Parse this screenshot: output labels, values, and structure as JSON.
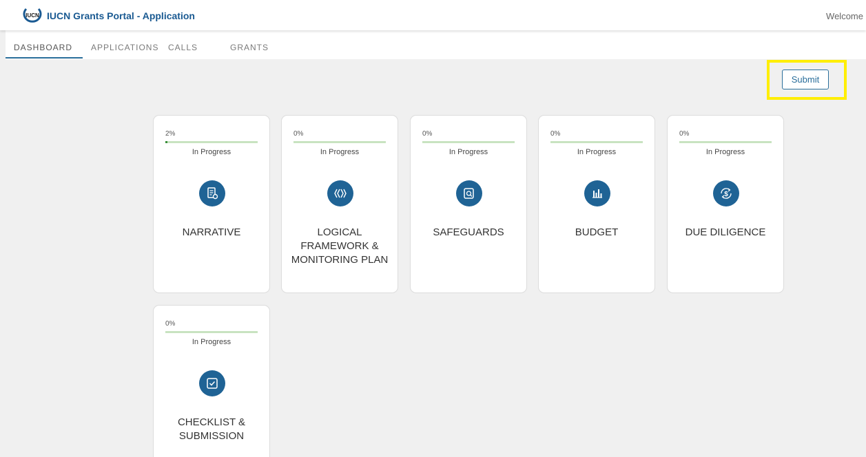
{
  "header": {
    "logo_text": "IUCN",
    "app_title": "IUCN Grants Portal - Application",
    "welcome": "Welcome"
  },
  "tabs": [
    {
      "label": "DASHBOARD",
      "active": true
    },
    {
      "label": "APPLICATIONS",
      "active": false
    },
    {
      "label": "CALLS",
      "active": false
    },
    {
      "label": "GRANTS",
      "active": false
    }
  ],
  "actions": {
    "submit_label": "Submit"
  },
  "cards": [
    {
      "progress_label": "2%",
      "progress": 2,
      "status": "In Progress",
      "icon": "narrative-icon",
      "title": "NARRATIVE"
    },
    {
      "progress_label": "0%",
      "progress": 0,
      "status": "In Progress",
      "icon": "logical-framework-icon",
      "title": "LOGICAL FRAMEWORK & MONITORING PLAN"
    },
    {
      "progress_label": "0%",
      "progress": 0,
      "status": "In Progress",
      "icon": "safeguards-icon",
      "title": "SAFEGUARDS"
    },
    {
      "progress_label": "0%",
      "progress": 0,
      "status": "In Progress",
      "icon": "budget-icon",
      "title": "BUDGET"
    },
    {
      "progress_label": "0%",
      "progress": 0,
      "status": "In Progress",
      "icon": "due-diligence-icon",
      "title": "DUE DILIGENCE"
    },
    {
      "progress_label": "0%",
      "progress": 0,
      "status": "In Progress",
      "icon": "checklist-icon",
      "title": "CHECKLIST & SUBMISSION"
    }
  ],
  "colors": {
    "brand": "#1a5a92",
    "icon_bg": "#1f6395",
    "progress_track": "#c8e3c0",
    "progress_fill": "#3a8e3a",
    "highlight": "#ffee00"
  }
}
